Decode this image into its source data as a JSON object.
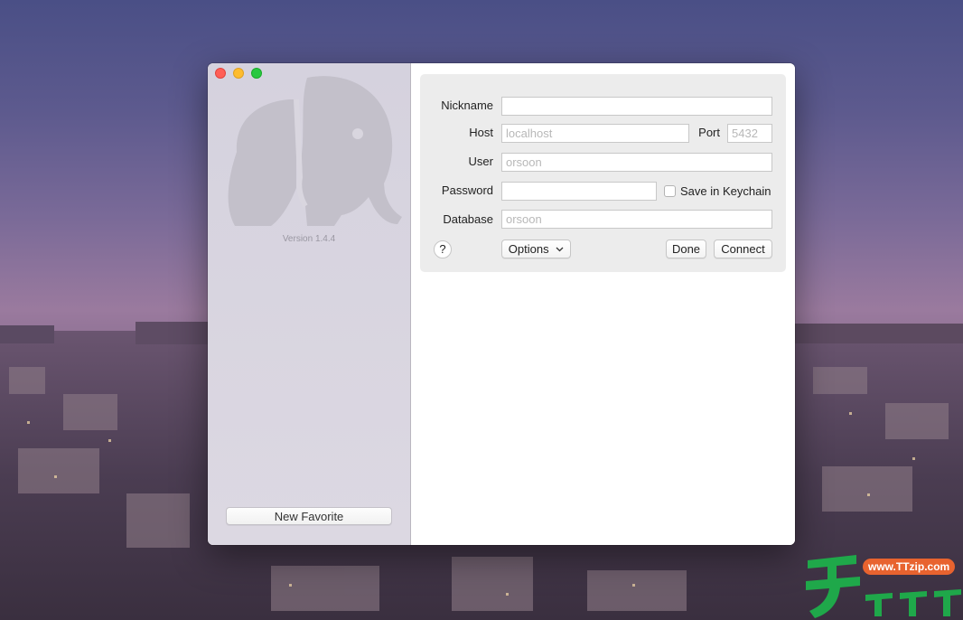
{
  "sidebar": {
    "version": "Version 1.4.4",
    "new_favorite_label": "New Favorite"
  },
  "icons": {
    "close": "close-icon",
    "minimize": "minimize-icon",
    "maximize": "maximize-icon",
    "logo": "elephant-logo-icon",
    "help": "help-icon",
    "chevron": "chevron-down-icon"
  },
  "form": {
    "nickname_label": "Nickname",
    "nickname_value": "",
    "host_label": "Host",
    "host_placeholder": "localhost",
    "port_label": "Port",
    "port_placeholder": "5432",
    "user_label": "User",
    "user_placeholder": "orsoon",
    "password_label": "Password",
    "password_value": "",
    "keychain_label": "Save in Keychain",
    "database_label": "Database",
    "database_placeholder": "orsoon",
    "help_label": "?",
    "options_label": "Options",
    "done_label": "Done",
    "connect_label": "Connect"
  },
  "watermark": {
    "url": "www.TTzip.com"
  },
  "colors": {
    "close": "#ff5f57",
    "minimize": "#febc2e",
    "maximize": "#28c840",
    "watermark_green": "#1fa84a",
    "watermark_orange": "#e8632f"
  }
}
